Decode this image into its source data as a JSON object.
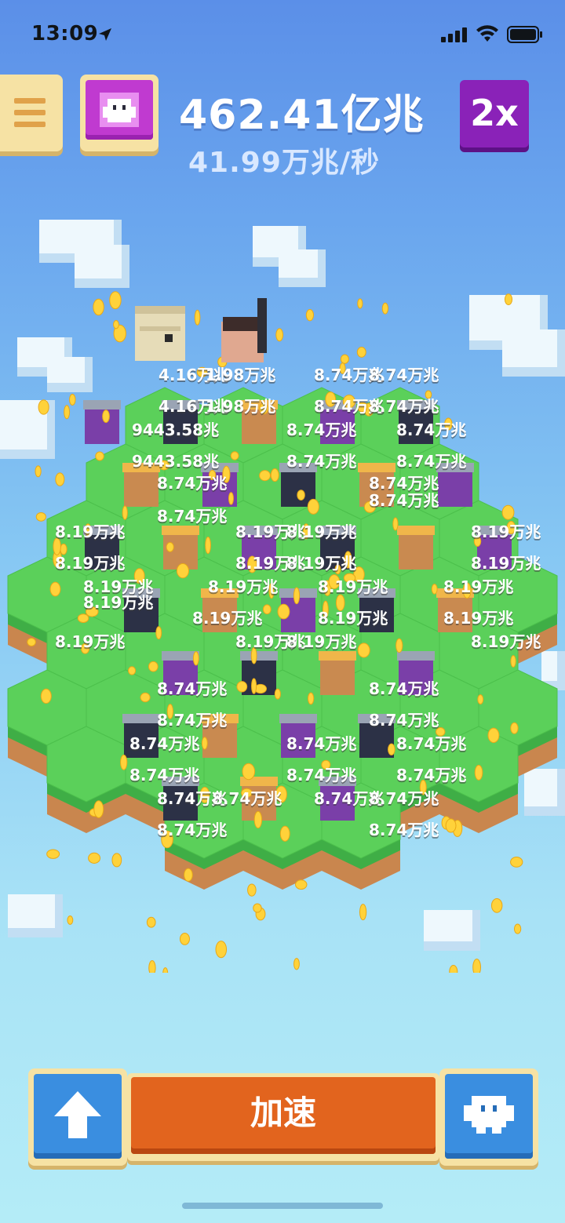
{
  "status_bar": {
    "time": "13:09",
    "location_icon": "location-arrow-icon",
    "signal_icon": "signal-bars-icon",
    "wifi_icon": "wifi-icon",
    "battery_icon": "battery-icon"
  },
  "hud": {
    "menu_icon": "hamburger-menu-icon",
    "avatar_icon": "character-face-icon",
    "total_currency": "462.41亿兆",
    "income_rate": "41.99万兆/秒",
    "multiplier_label": "2x"
  },
  "floating_labels": [
    "4.16万兆",
    "1.98万兆",
    "4.16万兆",
    "1.98万兆",
    "8.74万兆",
    "8.74万兆",
    "8.74万兆",
    "8.74万兆",
    "9443.58兆",
    "9443.58兆",
    "8.74万兆",
    "8.74万兆",
    "8.74万兆",
    "8.74万兆",
    "8.74万兆",
    "8.74万兆",
    "8.74万兆",
    "8.74万兆",
    "8.19万兆",
    "8.19万兆",
    "8.19万兆",
    "8.19万兆",
    "8.19万兆",
    "8.19万兆",
    "8.19万兆",
    "8.19万兆",
    "8.19万兆",
    "8.19万兆",
    "8.19万兆",
    "8.19万兆",
    "8.19万兆",
    "8.19万兆",
    "8.19万兆",
    "8.19万兆",
    "8.19万兆",
    "8.19万兆",
    "8.19万兆",
    "8.19万兆",
    "8.74万兆",
    "8.74万兆",
    "8.74万兆",
    "8.74万兆",
    "8.74万兆",
    "8.74万兆",
    "8.74万兆",
    "8.74万兆",
    "8.74万兆",
    "8.74万兆",
    "8.74万兆",
    "8.74万兆",
    "8.74万兆",
    "8.74万兆",
    "8.74万兆",
    "8.74万兆"
  ],
  "bottom_bar": {
    "upgrade_icon": "up-arrow-icon",
    "boost_label": "加速",
    "character_icon": "character-face-icon"
  },
  "colors": {
    "sky_top": "#5b8fe8",
    "sky_bottom": "#b4ecf7",
    "grass": "#5bd05a",
    "coin": "#ffd23a",
    "boost_button": "#e2641e",
    "multiplier_button": "#8a22b8",
    "avatar_button": "#c03ad0"
  }
}
